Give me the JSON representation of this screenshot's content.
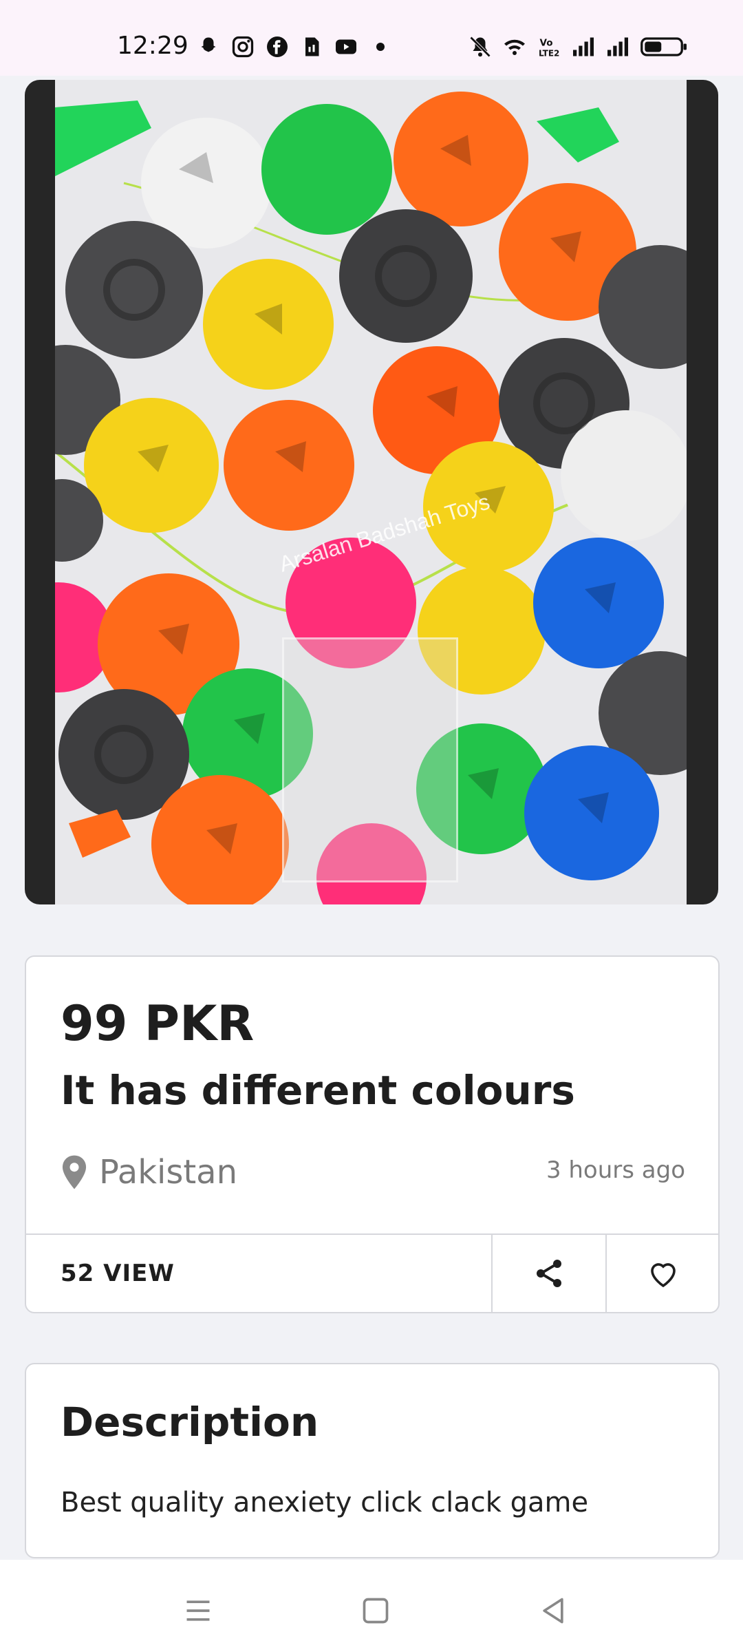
{
  "status_bar": {
    "time": "12:29",
    "left_icons": [
      "snapchat-icon",
      "instagram-icon",
      "facebook-icon",
      "sim-icon",
      "youtube-icon",
      "dot-icon"
    ],
    "right_icons": [
      "mute-icon",
      "wifi-icon",
      "volte-icon",
      "signal-icon",
      "signal-icon",
      "battery-icon"
    ]
  },
  "media": {
    "watermark": "Arsalan Badshah Toys"
  },
  "listing": {
    "price": "99 PKR",
    "title": "It has different colours",
    "location": "Pakistan",
    "posted": "3 hours ago",
    "views": "52 VIEW"
  },
  "description": {
    "heading": "Description",
    "text": "Best quality anexiety click clack game"
  },
  "colors": {
    "background": "#f1f2f6",
    "card": "#ffffff",
    "text": "#1e1e1e",
    "muted": "#7a7a7a"
  }
}
